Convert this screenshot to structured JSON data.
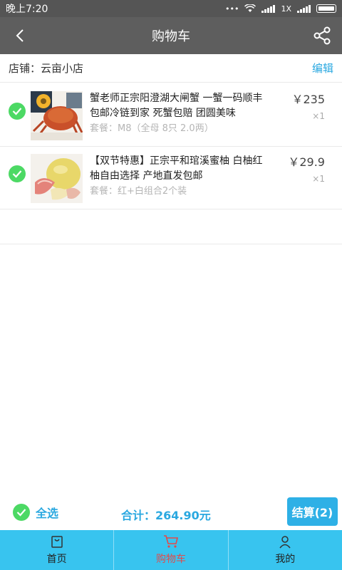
{
  "status_bar": {
    "time": "晚上7:20",
    "network": "1X"
  },
  "header": {
    "title": "购物车"
  },
  "shop": {
    "label": "店铺：云亩小店",
    "edit": "编辑"
  },
  "items": [
    {
      "title": "蟹老师正宗阳澄湖大闸蟹 一蟹一码顺丰包邮冷链到家 死蟹包赔 团圆美味",
      "spec": "套餐：M8（全母 8只 2.0两）",
      "price": "￥235",
      "qty": "×1",
      "checked": true
    },
    {
      "title": "【双节特惠】正宗平和琯溪蜜柚 白柚红柚自由选择 产地直发包邮",
      "spec": "套餐：红+白组合2个装",
      "price": "￥29.9",
      "qty": "×1",
      "checked": true
    }
  ],
  "footer": {
    "select_all": "全选",
    "total": "合计：264.90元",
    "checkout": "结算(2)"
  },
  "tabs": [
    {
      "label": "首页",
      "icon": "home-bag-icon"
    },
    {
      "label": "购物车",
      "icon": "cart-icon",
      "active": true
    },
    {
      "label": "我的",
      "icon": "user-icon"
    }
  ],
  "colors": {
    "accent": "#2aa8e0",
    "check": "#4cd964",
    "tabbar": "#38c4ef",
    "active_tab": "#e24a4a"
  }
}
